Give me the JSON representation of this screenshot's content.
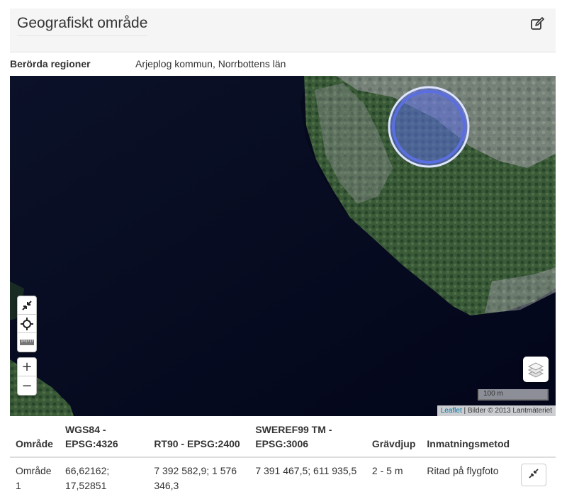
{
  "panel": {
    "title": "Geografiskt område",
    "edit_icon": "edit-icon"
  },
  "regions": {
    "label": "Berörda regioner",
    "value": "Arjeplog kommun, Norrbottens län"
  },
  "map": {
    "controls": {
      "fullscreen_icon": "collapse-arrows-icon",
      "locate_icon": "crosshair-icon",
      "measure_icon": "ruler-icon",
      "zoom_in": "+",
      "zoom_out": "−"
    },
    "layers_icon": "layers-icon",
    "scale_label": "100 m",
    "attribution": {
      "link": "Leaflet",
      "separator": " | ",
      "text": "Bilder © 2013 Lantmäteriet"
    },
    "marker_color": "#5b6ee1"
  },
  "table": {
    "headers": [
      "Område",
      "WGS84 - EPSG:4326",
      "RT90 - EPSG:2400",
      "SWEREF99 TM - EPSG:3006",
      "Grävdjup",
      "Inmatningsmetod"
    ],
    "rows": [
      {
        "area": "Område 1",
        "wgs84": "66,62162; 17,52851",
        "rt90": "7 392 582,9; 1 576 346,3",
        "sweref": "7 391 467,5; 611 935,5",
        "depth": "2 - 5 m",
        "method": "Ritad på flygfoto",
        "action_icon": "collapse-icon"
      }
    ]
  }
}
